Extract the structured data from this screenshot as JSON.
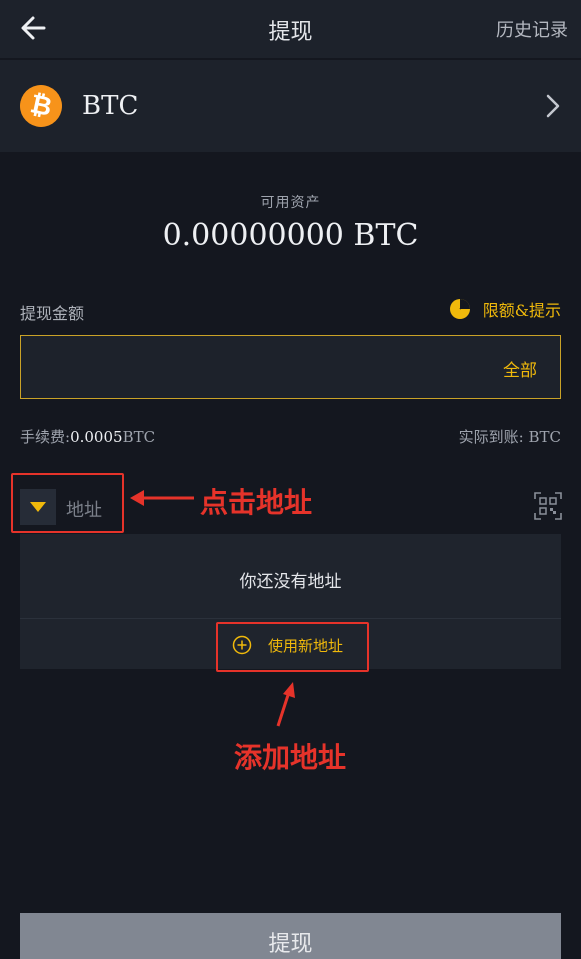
{
  "header": {
    "title": "提现",
    "history_label": "历史记录",
    "back_icon": "arrow-left-icon"
  },
  "coin": {
    "symbol_glyph": "₿",
    "name": "BTC",
    "icon": "bitcoin-icon",
    "chevron_icon": "chevron-right-icon",
    "brand_color": "#f7931a"
  },
  "balance": {
    "label": "可用资产",
    "value": "0.00000000 BTC"
  },
  "amount": {
    "label": "提现金额",
    "limit_label": "限额&提示",
    "limit_icon": "pie-chart-icon",
    "all_label": "全部",
    "input_value": ""
  },
  "fee": {
    "label": "手续费:",
    "value": "0.0005",
    "unit": "BTC",
    "arrive_label": "实际到账: BTC"
  },
  "address": {
    "label": "地址",
    "dropdown_icon": "triangle-down-icon",
    "qr_icon": "qr-scan-icon",
    "empty_text": "你还没有地址",
    "new_address_label": "使用新地址",
    "new_address_icon": "plus-circle-icon"
  },
  "annotations": {
    "click_address": "点击地址",
    "add_address": "添加地址"
  },
  "submit": {
    "label": "提现"
  },
  "colors": {
    "accent": "#f0b90b",
    "annotation": "#e6332a",
    "background": "#14171f",
    "panel": "#1d222b",
    "button_disabled": "#818792"
  }
}
